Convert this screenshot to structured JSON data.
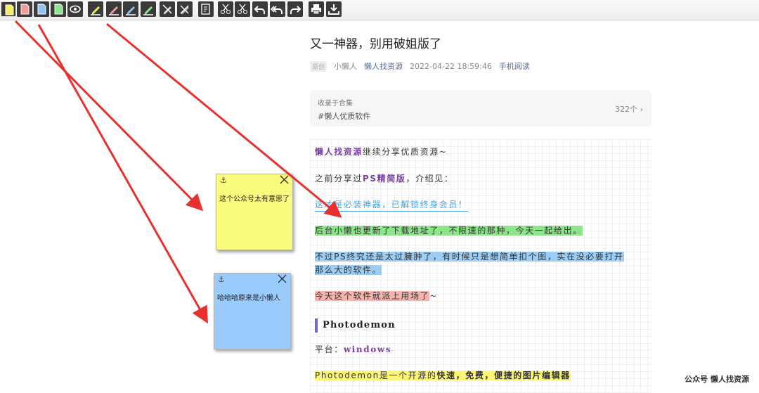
{
  "toolbar": {
    "buttons": [
      "yellow-note",
      "red-note",
      "blue-note",
      "green-note",
      "eye",
      "yellow-highlighter",
      "red-highlighter",
      "blue-highlighter",
      "green-highlighter",
      "erase-highlight",
      "erase-all",
      "edit-page",
      "scissors-1",
      "scissors-2",
      "undo",
      "undo-all",
      "redo",
      "print",
      "download"
    ]
  },
  "article": {
    "title": "又一神器，别用破姐版了",
    "meta": {
      "badge": "原创",
      "author": "小懒人",
      "account": "懒人找资源",
      "datetime": "2022-04-22 18:59:46",
      "mobile": "手机阅读"
    },
    "collection": {
      "label": "收录于合集",
      "tag": "#懒人优质软件",
      "count": "322个 ›"
    },
    "p1_brand": "懒人找资源",
    "p1_rest": "继续分享优质资源~",
    "p2_before": "之前分享过",
    "p2_brand": "PS精简版",
    "p2_after": "，介绍见：",
    "p3_link": "这才是必装神器，已解锁终身会员！",
    "p4": "后台小懒也更新了下载地址了，不限速的那种，今天一起给出。",
    "p5_line1": "不过PS终究还是太过臃肿了，有时候只是想简单扣个图，实在没必要打开",
    "p5_line2": "那么大的软件。",
    "p6_hl": "今天这个软件就派上用场了",
    "p6_tail": "~",
    "section_title": "Photodemon",
    "platform_label": "平台：",
    "platform_value": "windows",
    "p8_prefix": "Photodemon是一个开源的",
    "p8_bold": "快速，免费，便捷的图片编辑器"
  },
  "notes": [
    {
      "text": "这个公众号太有意思了",
      "color": "#fbfb7e"
    },
    {
      "text": "哈哈哈原来是小懒人",
      "color": "#99ccfd"
    }
  ],
  "watermark": "公众号  懒人找资源",
  "colors": {
    "arrow": "#e8312e",
    "purple": "#7b3fa0",
    "link": "#4aa3df"
  }
}
